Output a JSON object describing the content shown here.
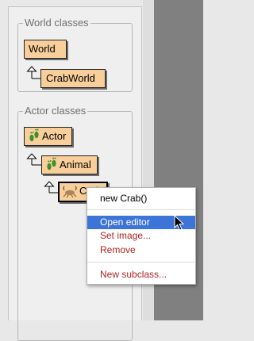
{
  "world_classes": {
    "title": "World classes",
    "items": [
      {
        "label": "World"
      },
      {
        "label": "CrabWorld"
      }
    ]
  },
  "actor_classes": {
    "title": "Actor classes",
    "items": [
      {
        "label": "Actor",
        "icon": "footprint-icon"
      },
      {
        "label": "Animal",
        "icon": "footprint-icon"
      },
      {
        "label": "Crab",
        "icon": "crab-icon",
        "selected": true
      }
    ]
  },
  "context_menu": {
    "items": [
      {
        "label": "new Crab()"
      },
      {
        "label": "Open editor",
        "highlighted": true
      },
      {
        "label": "Set image..."
      },
      {
        "label": "Remove"
      },
      {
        "label": "New subclass..."
      }
    ]
  },
  "colors": {
    "class_fill": "#f8cf9a",
    "menu_highlight": "#3d74d8",
    "menu_text_red": "#b02222"
  }
}
